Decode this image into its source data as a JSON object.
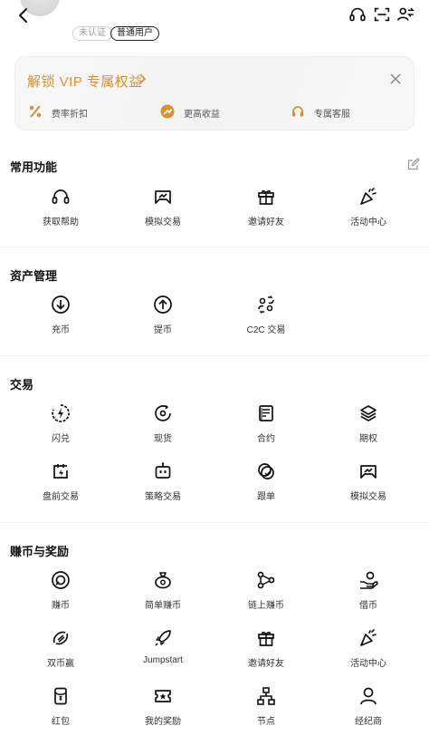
{
  "header": {
    "tag_cert": "未认证",
    "tag_user": "普通用户"
  },
  "vip": {
    "title": "解锁 VIP 专属权益",
    "perks": [
      {
        "label": "费率折扣",
        "icon": "percent-icon"
      },
      {
        "label": "更高收益",
        "icon": "yield-icon"
      },
      {
        "label": "专属客服",
        "icon": "headset-icon"
      }
    ]
  },
  "sections": {
    "common": {
      "title": "常用功能",
      "items": [
        {
          "label": "获取帮助",
          "icon": "headset-icon"
        },
        {
          "label": "模拟交易",
          "icon": "demo-trade-icon"
        },
        {
          "label": "邀请好友",
          "icon": "gift-icon"
        },
        {
          "label": "活动中心",
          "icon": "party-icon"
        }
      ]
    },
    "assets": {
      "title": "资产管理",
      "items": [
        {
          "label": "充币",
          "icon": "deposit-icon"
        },
        {
          "label": "提币",
          "icon": "withdraw-icon"
        },
        {
          "label": "C2C 交易",
          "icon": "c2c-icon"
        }
      ]
    },
    "trade": {
      "title": "交易",
      "items": [
        {
          "label": "闪兑",
          "icon": "flash-convert-icon"
        },
        {
          "label": "现货",
          "icon": "spot-icon"
        },
        {
          "label": "合约",
          "icon": "contract-icon"
        },
        {
          "label": "期权",
          "icon": "options-icon"
        },
        {
          "label": "盘前交易",
          "icon": "premarket-icon"
        },
        {
          "label": "策略交易",
          "icon": "bot-icon"
        },
        {
          "label": "跟单",
          "icon": "copy-trade-icon"
        },
        {
          "label": "模拟交易",
          "icon": "demo-trade-icon"
        }
      ]
    },
    "earn": {
      "title": "赚币与奖励",
      "items": [
        {
          "label": "赚币",
          "icon": "coin-icon"
        },
        {
          "label": "简单赚币",
          "icon": "money-bag-icon"
        },
        {
          "label": "链上赚币",
          "icon": "chain-icon"
        },
        {
          "label": "借币",
          "icon": "loan-icon"
        },
        {
          "label": "双币赢",
          "icon": "dual-coin-icon"
        },
        {
          "label": "Jumpstart",
          "icon": "rocket-icon"
        },
        {
          "label": "邀请好友",
          "icon": "gift-icon"
        },
        {
          "label": "活动中心",
          "icon": "party-icon"
        },
        {
          "label": "红包",
          "icon": "red-packet-icon"
        },
        {
          "label": "我的奖励",
          "icon": "ticket-icon"
        },
        {
          "label": "节点",
          "icon": "node-icon"
        },
        {
          "label": "经纪商",
          "icon": "broker-icon"
        }
      ]
    }
  },
  "colors": {
    "vip_accent": "#d9902f",
    "text": "#111111",
    "divider": "#f0f0f0"
  }
}
